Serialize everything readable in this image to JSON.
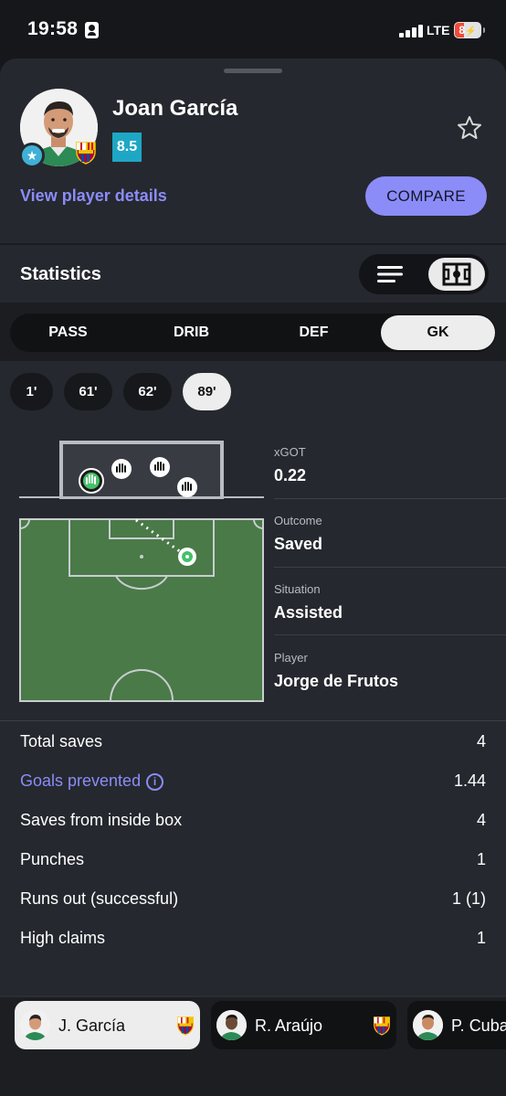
{
  "status_bar": {
    "time": "19:58",
    "network": "LTE",
    "battery": "8"
  },
  "player": {
    "name": "Joan García",
    "rating": "8.5",
    "view_details_label": "View player details",
    "compare_label": "COMPARE"
  },
  "statistics": {
    "title": "Statistics",
    "tabs": [
      {
        "label": "PASS",
        "active": false
      },
      {
        "label": "DRIB",
        "active": false
      },
      {
        "label": "DEF",
        "active": false
      },
      {
        "label": "GK",
        "active": true
      }
    ],
    "minutes": [
      {
        "label": "1'",
        "active": false
      },
      {
        "label": "61'",
        "active": false
      },
      {
        "label": "62'",
        "active": false
      },
      {
        "label": "89'",
        "active": true
      }
    ]
  },
  "shot": {
    "xgot_label": "xGOT",
    "xgot_value": "0.22",
    "outcome_label": "Outcome",
    "outcome_value": "Saved",
    "situation_label": "Situation",
    "situation_value": "Assisted",
    "player_label": "Player",
    "player_value": "Jorge de Frutos"
  },
  "gk_stats": [
    {
      "label": "Total saves",
      "value": "4",
      "link": false
    },
    {
      "label": "Goals prevented",
      "value": "1.44",
      "link": true
    },
    {
      "label": "Saves from inside box",
      "value": "4",
      "link": false
    },
    {
      "label": "Punches",
      "value": "1",
      "link": false
    },
    {
      "label": "Runs out (successful)",
      "value": "1 (1)",
      "link": false
    },
    {
      "label": "High claims",
      "value": "1",
      "link": false
    }
  ],
  "lineup": [
    {
      "name": "J. García",
      "active": true
    },
    {
      "name": "R. Araújo",
      "active": false
    },
    {
      "name": "P. Cuba",
      "active": false
    }
  ],
  "colors": {
    "accent": "#8b8cf7",
    "rating_bg": "#1ea7c5",
    "pitch": "#4a7a48",
    "sheet_bg": "#25282e"
  }
}
